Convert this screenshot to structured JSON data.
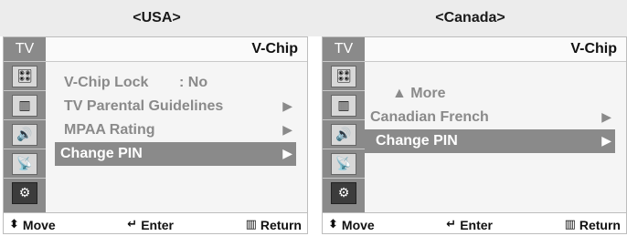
{
  "captions": {
    "usa": "<USA>",
    "canada": "<Canada>"
  },
  "sidebar": {
    "tv_label": "TV",
    "icons": [
      "remote-icon",
      "channel-icon",
      "sound-icon",
      "antenna-icon",
      "setup-icon"
    ]
  },
  "usa": {
    "title": "V-Chip",
    "items": [
      {
        "label": "V-Chip Lock",
        "value": ": No"
      },
      {
        "label": "TV Parental Guidelines",
        "arrow": "▶"
      },
      {
        "label": "MPAA Rating",
        "arrow": "▶"
      },
      {
        "label": "Change PIN",
        "arrow": "▶"
      }
    ]
  },
  "canada": {
    "title": "V-Chip",
    "items": [
      {
        "label": "▲ More"
      },
      {
        "label": "Canadian French",
        "arrow": "▶"
      },
      {
        "label": "Change PIN",
        "arrow": "▶"
      }
    ]
  },
  "footer": {
    "move_icon": "⬍",
    "move": "Move",
    "enter_icon": "↵",
    "enter": "Enter",
    "return_icon": "▥",
    "return": "Return"
  }
}
